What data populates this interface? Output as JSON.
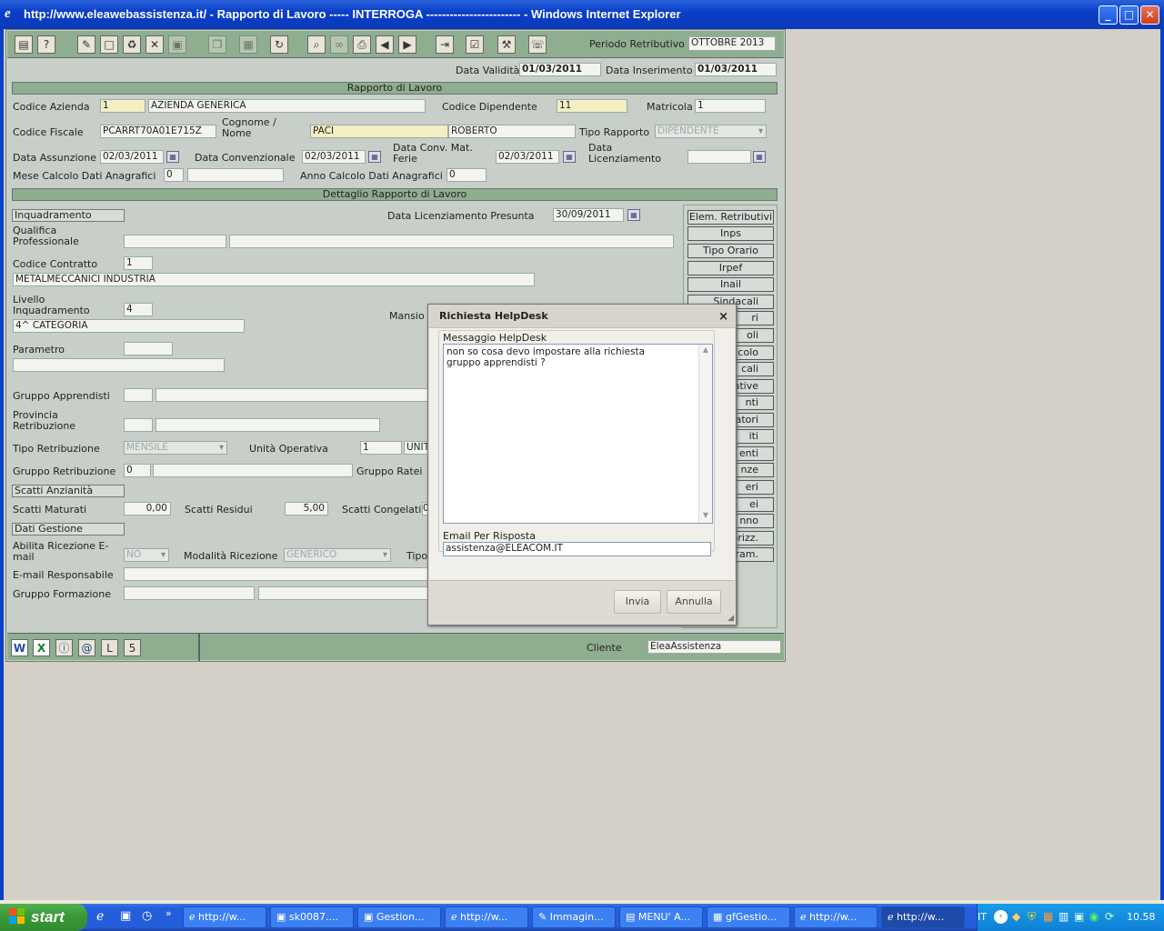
{
  "window": {
    "title": "http://www.eleawebassistenza.it/ - Rapporto di Lavoro ----- INTERROGA ------------------------ - Windows Internet Explorer"
  },
  "toolbar": {
    "periodo_label": "Periodo Retributivo",
    "periodo_value": "OTTOBRE 2013"
  },
  "header": {
    "data_validita_label": "Data Validità",
    "data_validita": "01/03/2011",
    "data_inserimento_label": "Data Inserimento",
    "data_inserimento": "01/03/2011"
  },
  "section1": {
    "title": "Rapporto di Lavoro"
  },
  "form": {
    "codice_azienda_label": "Codice Azienda",
    "codice_azienda": "1",
    "azienda_nome": "AZIENDA GENERICA",
    "codice_dipendente_label": "Codice Dipendente",
    "codice_dipendente": "11",
    "matricola_label": "Matricola",
    "matricola": "1",
    "codice_fiscale_label": "Codice Fiscale",
    "codice_fiscale": "PCARRT70A01E715Z",
    "cognome_label_1": "Cognome /",
    "cognome_label_2": "Nome",
    "cognome": "PACI",
    "nome": "ROBERTO",
    "tipo_rapporto_label": "Tipo Rapporto",
    "tipo_rapporto": "DIPENDENTE",
    "data_assunzione_label": "Data Assunzione",
    "data_assunzione": "02/03/2011",
    "data_convenzionale_label": "Data Convenzionale",
    "data_convenzionale": "02/03/2011",
    "data_conv_mat_label_1": "Data Conv. Mat.",
    "data_conv_mat_label_2": "Ferie",
    "data_conv_mat": "02/03/2011",
    "data_licenziamento_label_1": "Data",
    "data_licenziamento_label_2": "Licenziamento",
    "data_licenziamento": "",
    "mese_calcolo_label": "Mese Calcolo Dati Anagrafici",
    "mese_calcolo": "0",
    "anno_calcolo_label": "Anno Calcolo Dati Anagrafici",
    "anno_calcolo": "0"
  },
  "section2": {
    "title": "Dettaglio Rapporto di Lavoro"
  },
  "detail": {
    "inquadramento": "Inquadramento",
    "data_lic_presunta_label": "Data Licenziamento Presunta",
    "data_lic_presunta": "30/09/2011",
    "qualifica_label_1": "Qualifica",
    "qualifica_label_2": "Professionale",
    "codice_contratto_label": "Codice Contratto",
    "codice_contratto": "1",
    "contratto_desc": "METALMECCANICI INDUSTRIA",
    "livello_label_1": "Livello",
    "livello_label_2": "Inquadramento",
    "livello": "4",
    "livello_desc": "4^ CATEGORIA",
    "mansione_label": "Mansio",
    "parametro_label": "Parametro",
    "gruppo_apprendisti_label": "Gruppo Apprendisti",
    "provincia_label_1": "Provincia",
    "provincia_label_2": "Retribuzione",
    "tipo_retribuzione_label": "Tipo Retribuzione",
    "tipo_retribuzione": "MENSILE",
    "unita_operativa_label": "Unità Operativa",
    "unita_operativa": "1",
    "unita_operativa_desc": "UNIT",
    "gruppo_retribuzione_label": "Gruppo Retribuzione",
    "gruppo_retribuzione": "0",
    "gruppo_ratei_label": "Gruppo Ratei",
    "scatti_anzianita": "Scatti Anzianità",
    "scatti_maturati_label": "Scatti Maturati",
    "scatti_maturati": "0,00",
    "scatti_residui_label": "Scatti Residui",
    "scatti_residui": "5,00",
    "scatti_congelati_label": "Scatti Congelati",
    "scatti_congelati": "0",
    "dati_gestione": "Dati Gestione",
    "abilita_label_1": "Abilita Ricezione E-",
    "abilita_label_2": "mail",
    "abilita": "NO",
    "modalita_label": "Modalità Ricezione",
    "modalita": "GENERICO",
    "tipo_label": "Tipo",
    "email_resp_label": "E-mail Responsabile",
    "gruppo_formazione_label": "Gruppo Formazione"
  },
  "right_buttons": [
    "Elem. Retributivi",
    "Inps",
    "Tipo Orario",
    "Irpef",
    "Inail",
    "Sindacali",
    "ri",
    "oli",
    "colo",
    "cali",
    "ative",
    "nti",
    "ratori",
    "iti",
    "enti",
    "nze",
    "eri",
    "ei",
    "nno",
    "torizz.",
    "adram."
  ],
  "bottom": {
    "cliente_label": "Cliente",
    "cliente": "EleaAssistenza"
  },
  "dialog": {
    "title": "Richiesta HelpDesk",
    "close": "×",
    "messaggio_label": "Messaggio HelpDesk",
    "messaggio": "non so cosa devo impostare alla richiesta\ngruppo apprendisti ?",
    "email_label": "Email Per Risposta",
    "email": "assistenza@ELEACOM.IT",
    "invia": "Invia",
    "annulla": "Annulla"
  },
  "taskbar": {
    "start": "start",
    "tasks": [
      "http://w...",
      "sk0087....",
      "Gestion...",
      "http://w...",
      "Immagin...",
      "MENU' A...",
      "gfGestio...",
      "http://w...",
      "http://w..."
    ],
    "lang": "IT",
    "clock": "10.58"
  }
}
